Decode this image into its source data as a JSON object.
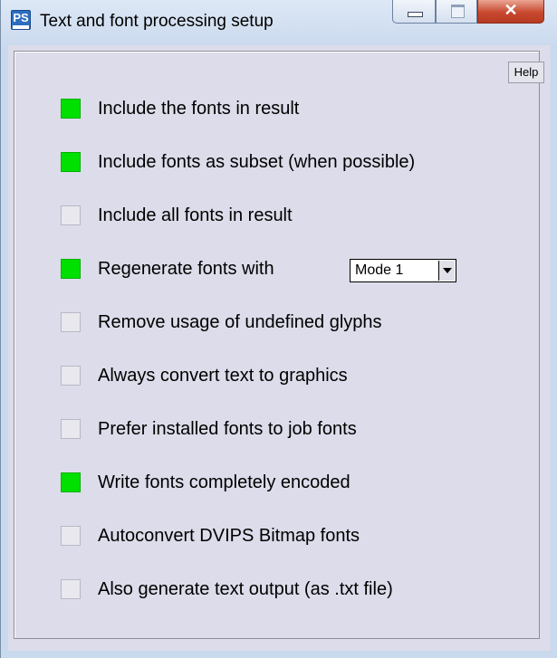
{
  "window": {
    "title": "Text and font processing setup",
    "icon_text": "PS"
  },
  "help_label": "Help",
  "options": [
    {
      "label": "Include the fonts in result",
      "checked": true
    },
    {
      "label": "Include fonts as subset (when possible)",
      "checked": true
    },
    {
      "label": "Include all fonts in result",
      "checked": false
    },
    {
      "label": "Regenerate fonts with",
      "checked": true
    },
    {
      "label": "Remove usage of undefined glyphs",
      "checked": false
    },
    {
      "label": "Always convert text to graphics",
      "checked": false
    },
    {
      "label": "Prefer installed fonts to job fonts",
      "checked": false
    },
    {
      "label": "Write fonts completely encoded",
      "checked": true
    },
    {
      "label": "Autoconvert DVIPS Bitmap fonts",
      "checked": false
    },
    {
      "label": "Also generate text output (as .txt file)",
      "checked": false
    }
  ],
  "mode_select": {
    "value": "Mode 1"
  },
  "colors": {
    "checked": "#00e000",
    "unchecked": "#e8e8ee",
    "background": "#dcdcea"
  }
}
